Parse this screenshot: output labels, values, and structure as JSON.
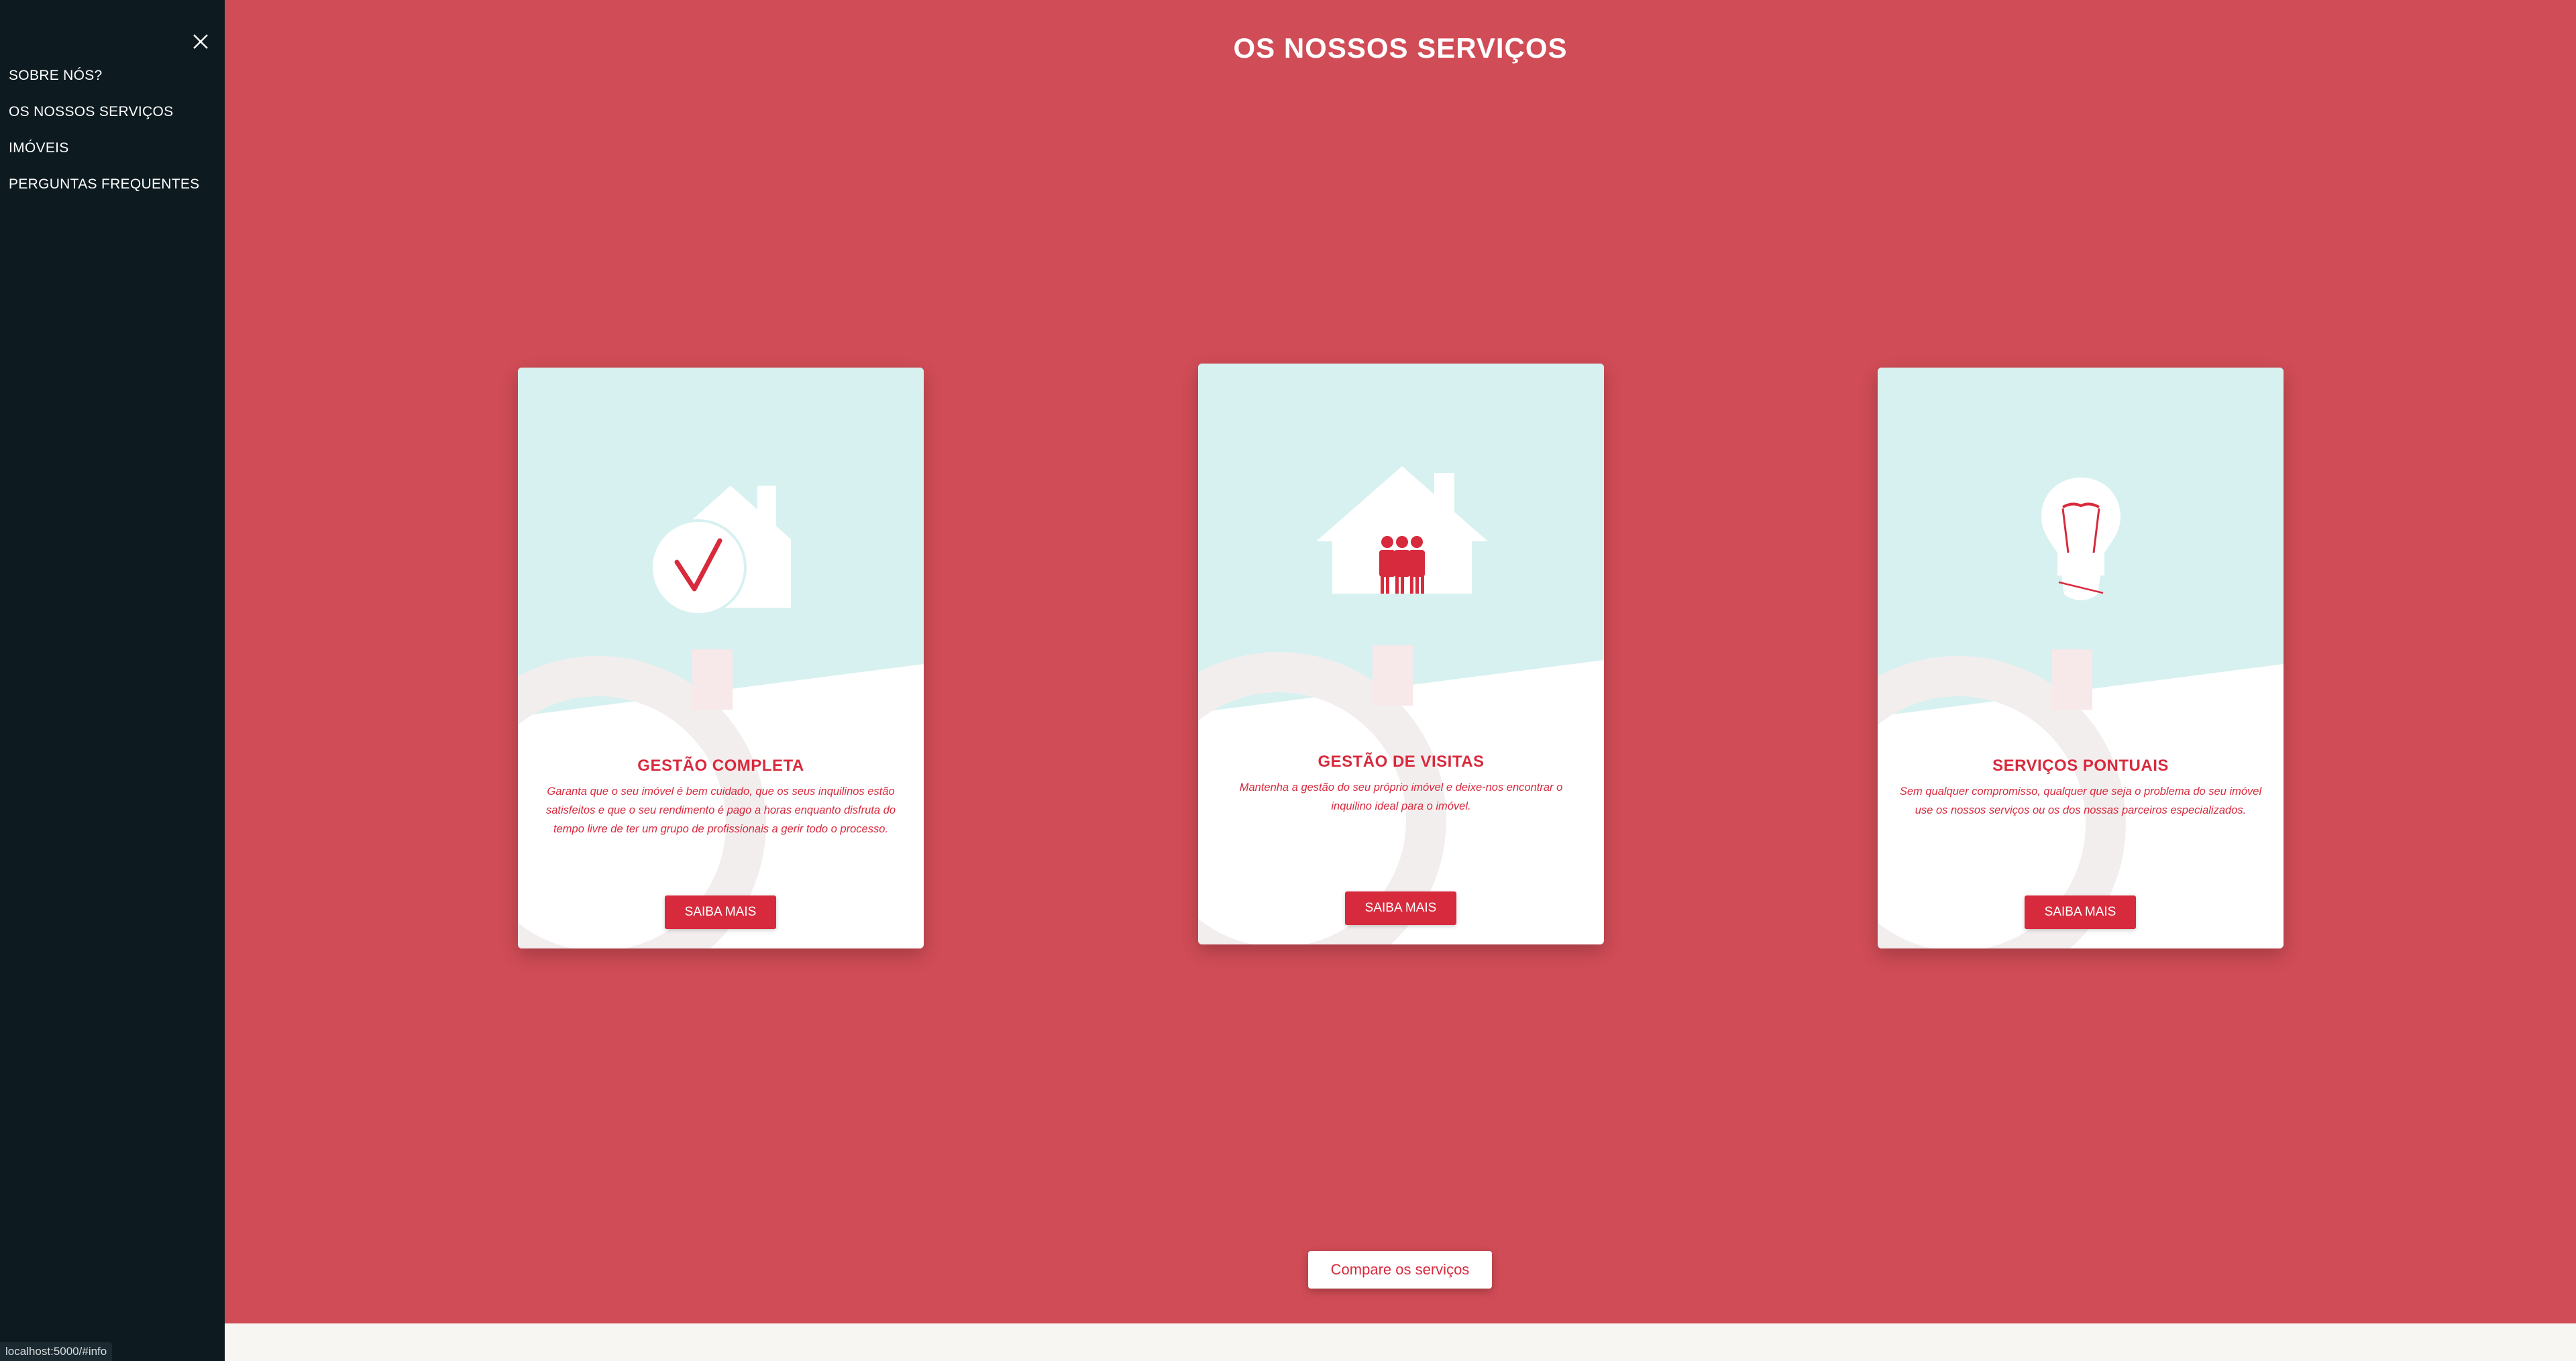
{
  "sidebar": {
    "close_icon": "close-icon",
    "items": [
      {
        "label": "SOBRE NÓS?"
      },
      {
        "label": "OS NOSSOS SERVIÇOS"
      },
      {
        "label": "IMÓVEIS"
      },
      {
        "label": "PERGUNTAS FREQUENTES"
      }
    ]
  },
  "main": {
    "title": "OS NOSSOS SERVIÇOS",
    "cards": [
      {
        "icon": "house-check-icon",
        "title": "GESTÃO COMPLETA",
        "text": "Garanta que o seu imóvel é bem cuidado, que os seus inquilinos estão satisfeitos e que o seu rendimento é pago a horas enquanto disfruta do tempo livre de ter um grupo de profissionais a gerir todo o processo.",
        "button": "SAIBA MAIS"
      },
      {
        "icon": "house-people-icon",
        "title": "GESTÃO DE VISITAS",
        "text": "Mantenha a gestão do seu próprio imóvel e deixe-nos encontrar o inquilino ideal para o imóvel.",
        "button": "SAIBA MAIS"
      },
      {
        "icon": "lightbulb-icon",
        "title": "SERVIÇOS PONTUAIS",
        "text": "Sem qualquer compromisso, qualquer que seja o problema do seu imóvel use os nossos serviços ou os dos nossas parceiros especializados.",
        "button": "SAIBA MAIS"
      }
    ],
    "compare_button": "Compare os serviços"
  },
  "status_bar": {
    "url": "localhost:5000/#info"
  },
  "colors": {
    "background": "#d04c56",
    "sidebar": "#0d1b21",
    "accent": "#d82a3d",
    "card_top": "#d7f1f0"
  }
}
